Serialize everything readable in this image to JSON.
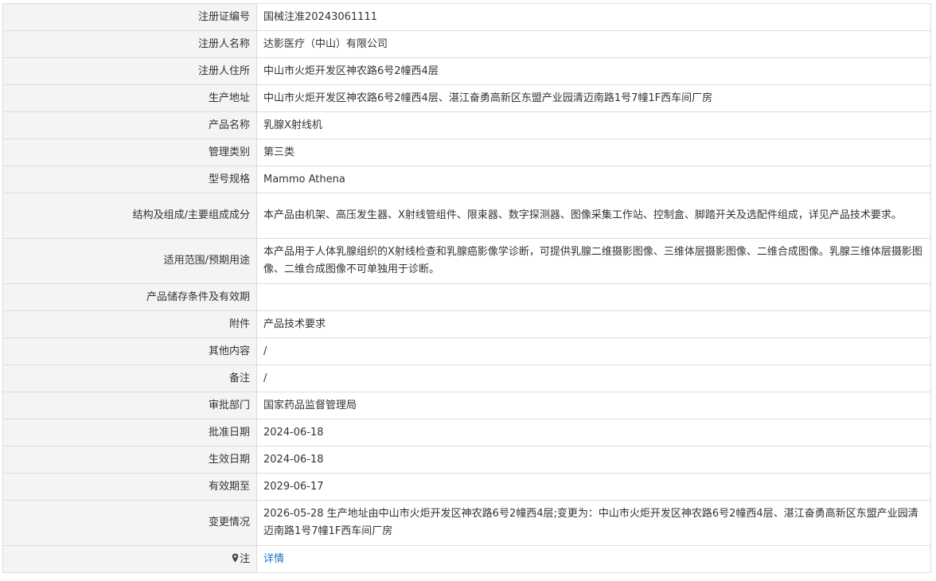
{
  "rows": [
    {
      "label": "注册证编号",
      "value": "国械注准20243061111"
    },
    {
      "label": "注册人名称",
      "value": "达影医疗（中山）有限公司"
    },
    {
      "label": "注册人住所",
      "value": "中山市火炬开发区神农路6号2幢西4层"
    },
    {
      "label": "生产地址",
      "value": "中山市火炬开发区神农路6号2幢西4层、湛江奋勇高新区东盟产业园清迈南路1号7幢1F西车间厂房"
    },
    {
      "label": "产品名称",
      "value": "乳腺X射线机"
    },
    {
      "label": "管理类别",
      "value": "第三类"
    },
    {
      "label": "型号规格",
      "value": "Mammo Athena"
    },
    {
      "label": "结构及组成/主要组成成分",
      "value": "本产品由机架、高压发生器、X射线管组件、限束器、数字探测器、图像采集工作站、控制盒、脚踏开关及选配件组成，详见产品技术要求。"
    },
    {
      "label": "适用范围/预期用途",
      "value": "本产品用于人体乳腺组织的X射线检查和乳腺癌影像学诊断，可提供乳腺二维摄影图像、三维体层摄影图像、二维合成图像。乳腺三维体层摄影图像、二维合成图像不可单独用于诊断。"
    },
    {
      "label": "产品储存条件及有效期",
      "value": ""
    },
    {
      "label": "附件",
      "value": "产品技术要求"
    },
    {
      "label": "其他内容",
      "value": "/"
    },
    {
      "label": "备注",
      "value": "/"
    },
    {
      "label": "审批部门",
      "value": "国家药品监督管理局"
    },
    {
      "label": "批准日期",
      "value": "2024-06-18"
    },
    {
      "label": "生效日期",
      "value": "2024-06-18"
    },
    {
      "label": "有效期至",
      "value": "2029-06-17"
    },
    {
      "label": "变更情况",
      "value": "2026-05-28 生产地址由中山市火炬开发区神农路6号2幢西4层;变更为：中山市火炬开发区神农路6号2幢西4层、湛江奋勇高新区东盟产业园清迈南路1号7幢1F西车间厂房"
    }
  ],
  "note_row": {
    "icon": "map-pin-icon",
    "label": "注",
    "link_text": "详情"
  },
  "colors": {
    "label_bg": "#f4f4f4",
    "border": "#dcdcdc",
    "link": "#1e70c8"
  }
}
